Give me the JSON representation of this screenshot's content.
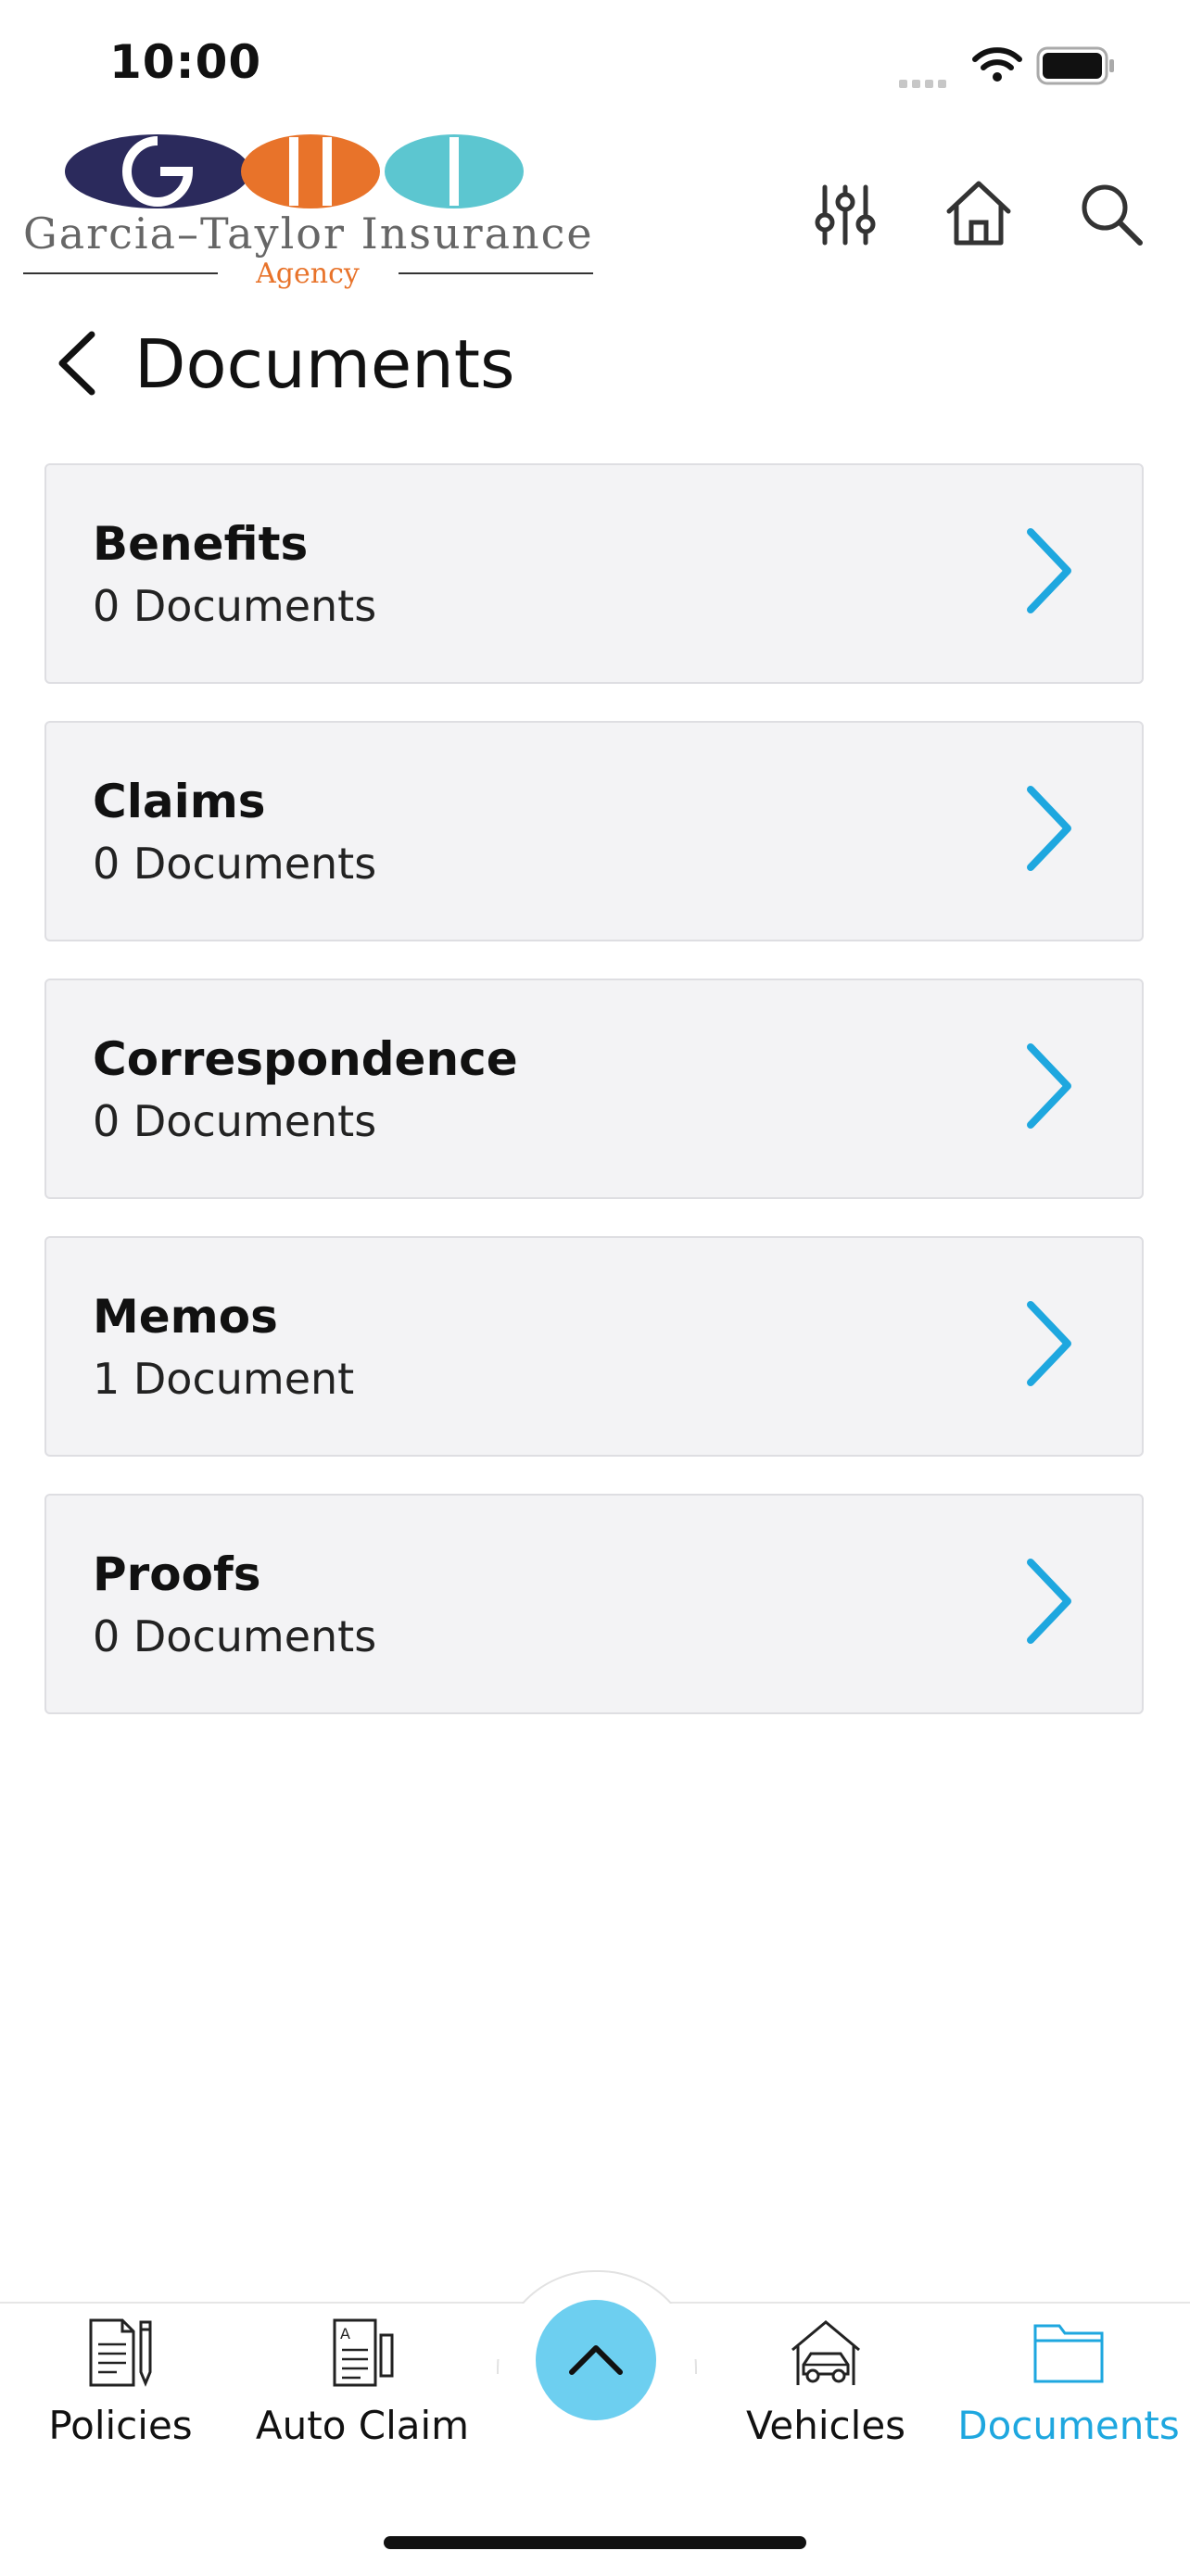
{
  "status_bar": {
    "time": "10:00"
  },
  "header": {
    "logo_text": "Garcia–Taylor Insurance",
    "logo_subtext": "Agency",
    "icons": [
      "sliders-icon",
      "home-icon",
      "search-icon"
    ]
  },
  "page": {
    "title": "Documents"
  },
  "categories": [
    {
      "name": "Benefits",
      "count": "0 Documents"
    },
    {
      "name": "Claims",
      "count": "0 Documents"
    },
    {
      "name": "Correspondence",
      "count": "0 Documents"
    },
    {
      "name": "Memos",
      "count": "1 Document"
    },
    {
      "name": "Proofs",
      "count": "0 Documents"
    }
  ],
  "tabbar": {
    "tabs": [
      {
        "label": "Policies",
        "icon": "policy-document-icon"
      },
      {
        "label": "Auto Claim",
        "icon": "claim-form-icon"
      },
      {
        "label": "Vehicles",
        "icon": "car-garage-icon"
      },
      {
        "label": "Documents",
        "icon": "folder-icon",
        "active": true
      }
    ],
    "fab_icon": "chevron-up-icon"
  },
  "colors": {
    "accent": "#1ea7df",
    "fab": "#6dcff0",
    "logo_navy": "#2b2a5c",
    "logo_orange": "#e8732a",
    "logo_teal": "#5cc6d0"
  }
}
